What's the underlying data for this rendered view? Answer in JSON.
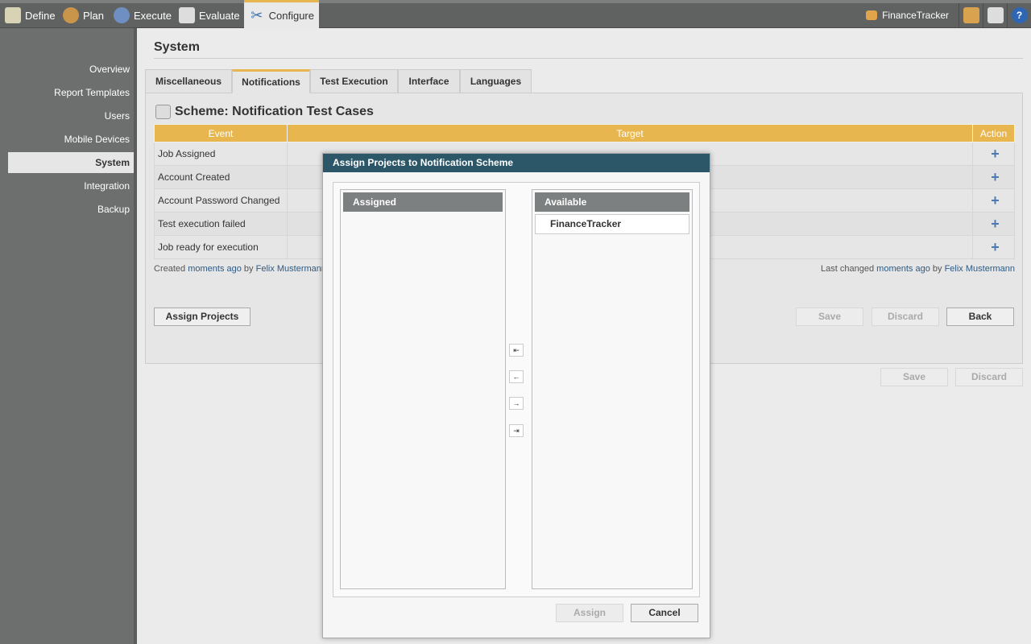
{
  "topnav": [
    {
      "label": "Define",
      "icon": "notepad-icon"
    },
    {
      "label": "Plan",
      "icon": "users-icon"
    },
    {
      "label": "Execute",
      "icon": "gear-icon"
    },
    {
      "label": "Evaluate",
      "icon": "report-icon"
    },
    {
      "label": "Configure",
      "icon": "tools-icon",
      "active": true
    }
  ],
  "project": "FinanceTracker",
  "sidebar": [
    "Overview",
    "Report Templates",
    "Users",
    "Mobile Devices",
    "System",
    "Integration",
    "Backup"
  ],
  "page_title": "System",
  "tabs": [
    "Miscellaneous",
    "Notifications",
    "Test Execution",
    "Interface",
    "Languages"
  ],
  "scheme_title": "Scheme: Notification Test Cases",
  "columns": [
    "Event",
    "Target",
    "Action"
  ],
  "events": [
    "Job Assigned",
    "Account Created",
    "Account Password Changed",
    "Test execution failed",
    "Job ready for execution"
  ],
  "meta": {
    "created_prefix": "Created",
    "created_when": "moments ago",
    "by": "by",
    "created_user": "Felix Mustermann",
    "changed_prefix": "Last changed",
    "changed_when": "moments ago",
    "changed_user": "Felix Mustermann"
  },
  "buttons": {
    "assign_projects": "Assign Projects",
    "save": "Save",
    "discard": "Discard",
    "back": "Back"
  },
  "dialog": {
    "title": "Assign Projects to Notification Scheme",
    "assigned": "Assigned",
    "available": "Available",
    "available_items": [
      "FinanceTracker"
    ],
    "assign": "Assign",
    "cancel": "Cancel",
    "move": [
      "⇤",
      "←",
      "→",
      "⇥"
    ]
  },
  "colors": {
    "accent": "#e8b64f",
    "dialog_header": "#2b5769"
  }
}
